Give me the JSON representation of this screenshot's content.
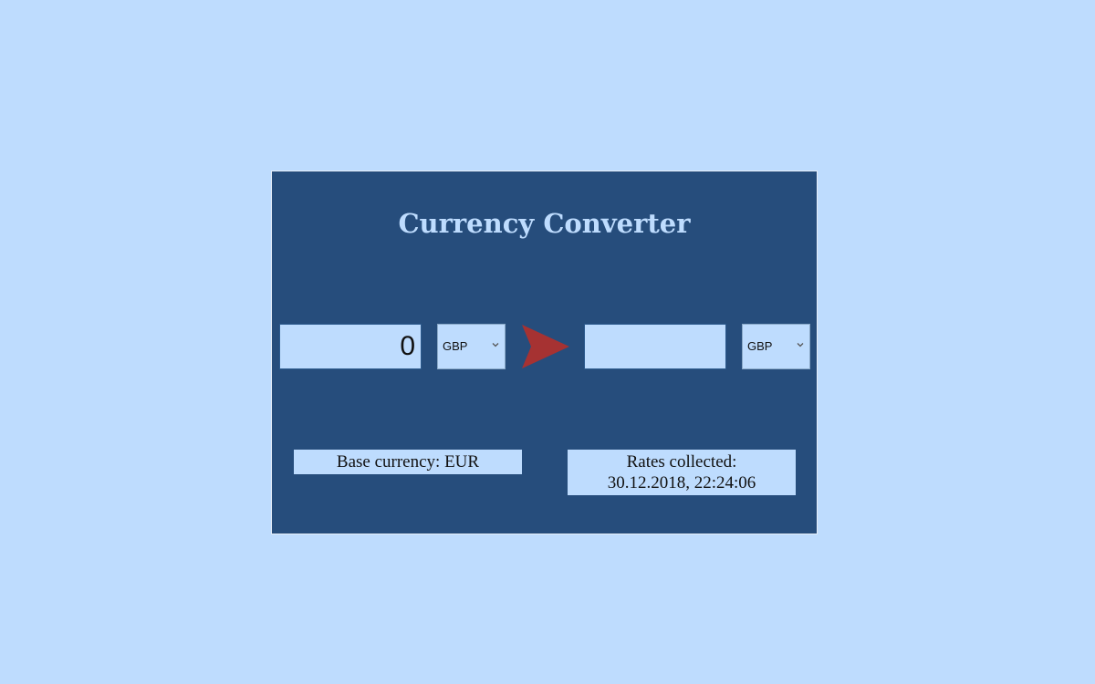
{
  "app": {
    "title": "Currency Converter"
  },
  "converter": {
    "amount_value": "0",
    "from_currency": "GBP",
    "to_currency": "GBP",
    "result_value": ""
  },
  "info": {
    "base_currency": "Base currency: EUR",
    "rates_label": "Rates collected:",
    "rates_timestamp": "30.12.2018, 22:24:06"
  },
  "colors": {
    "page_background": "#bedcfe",
    "panel_background": "#264d7c",
    "arrow": "#a63232"
  },
  "icons": {
    "convert": "arrow-right-icon",
    "dropdown": "chevron-down-icon"
  }
}
